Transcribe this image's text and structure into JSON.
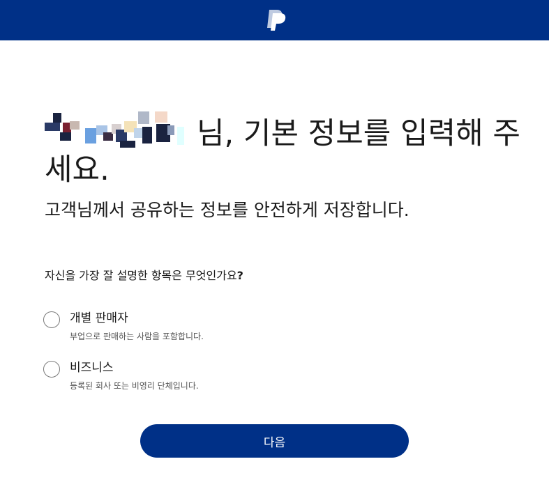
{
  "header": {
    "logo_icon": "paypal-logo-icon",
    "background": "#003087"
  },
  "heading": {
    "name_suffix": "님, 기본 정보를 입력해 주세요."
  },
  "subheading": "고객님께서 공유하는 정보를 안전하게 저장합니다.",
  "question": {
    "text": "자신을 가장 잘 설명한 항목은 무엇인가요",
    "mark": "?"
  },
  "options": [
    {
      "label": "개별 판매자",
      "description": "부업으로 판매하는 사람을 포함합니다.",
      "selected": false
    },
    {
      "label": "비즈니스",
      "description": "등록된 회사 또는 비영리 단체입니다.",
      "selected": false
    }
  ],
  "next_button": {
    "label": "다음",
    "color": "#003087"
  }
}
